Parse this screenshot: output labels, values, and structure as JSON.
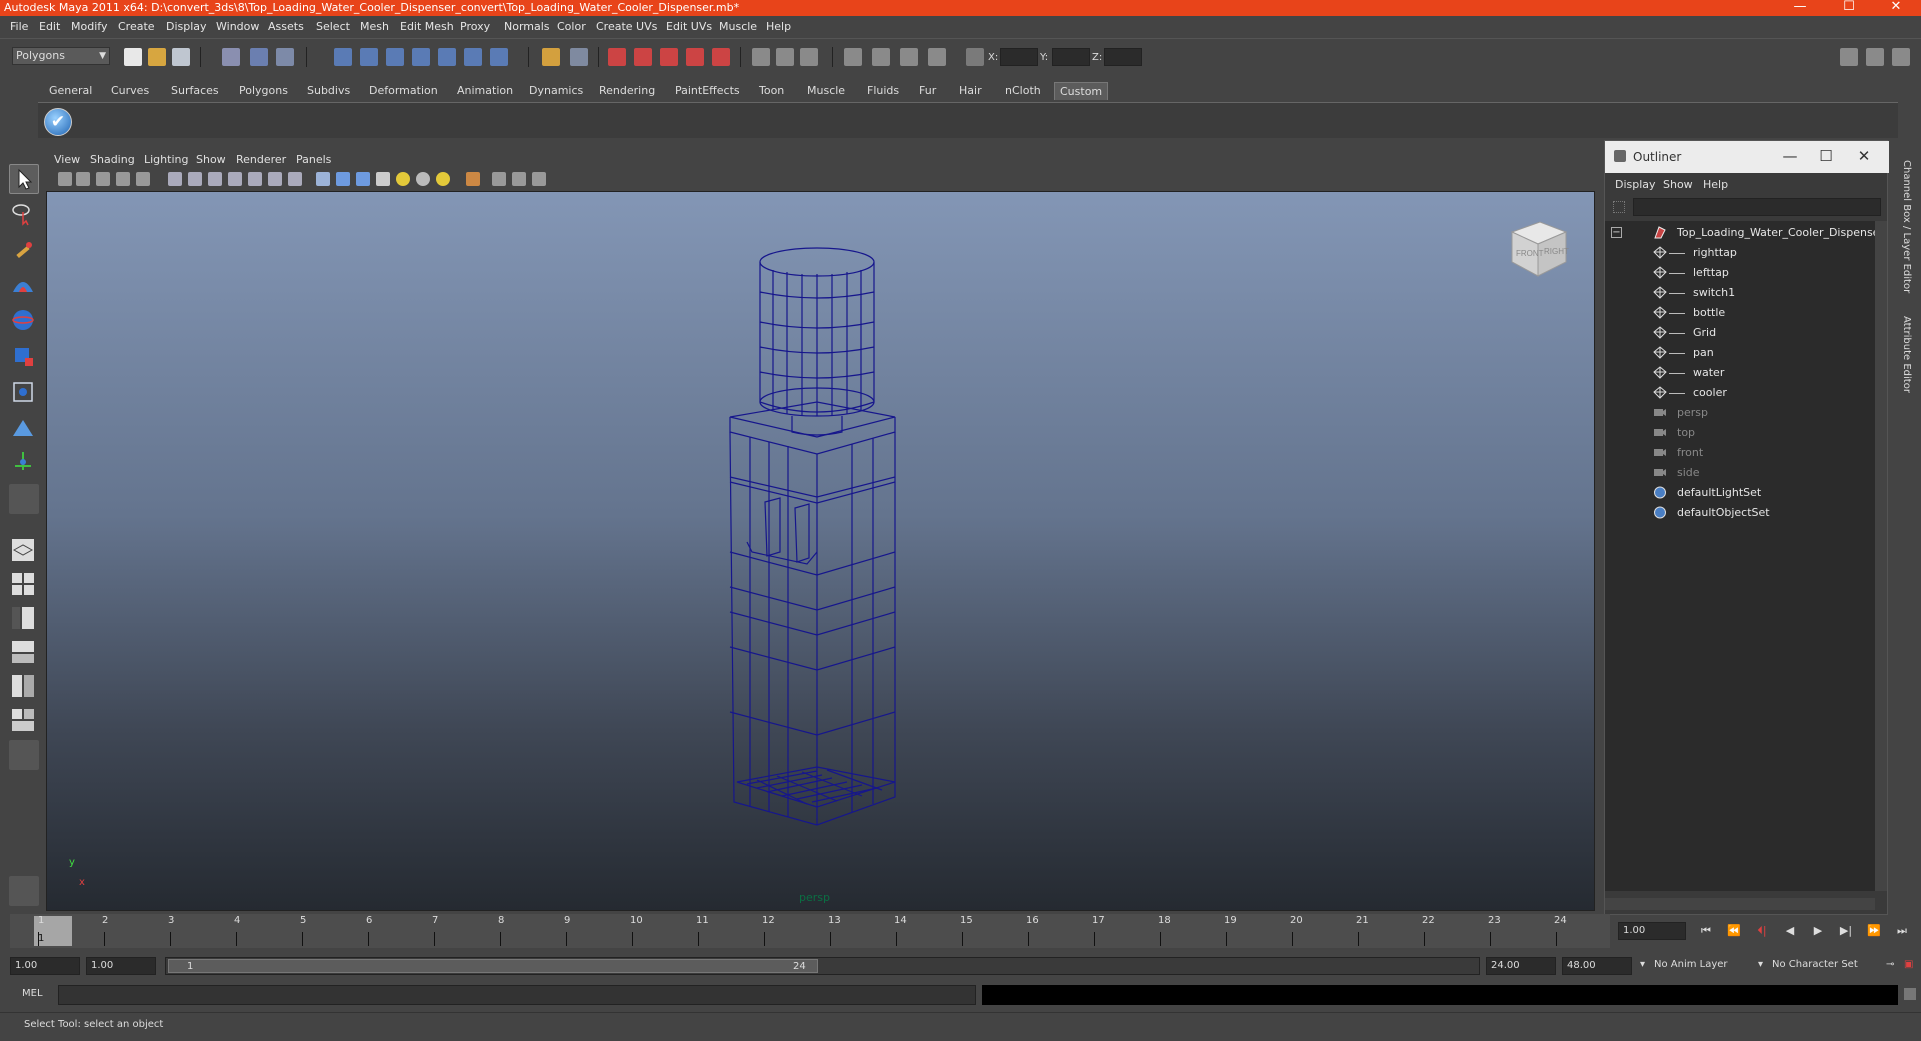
{
  "window": {
    "title": "Autodesk Maya 2011 x64: D:\\convert_3ds\\8\\Top_Loading_Water_Cooler_Dispenser_convert\\Top_Loading_Water_Cooler_Dispenser.mb*",
    "minimize": "—",
    "maximize": "☐",
    "close": "✕"
  },
  "menubar": [
    "File",
    "Edit",
    "Modify",
    "Create",
    "Display",
    "Window",
    "Assets",
    "Select",
    "Mesh",
    "Edit Mesh",
    "Proxy",
    "Normals",
    "Color",
    "Create UVs",
    "Edit UVs",
    "Muscle",
    "Help"
  ],
  "statusline": {
    "mode": "Polygons",
    "x_label": "X:",
    "y_label": "Y:",
    "z_label": "Z:"
  },
  "shelf_tabs": [
    "General",
    "Curves",
    "Surfaces",
    "Polygons",
    "Subdivs",
    "Deformation",
    "Animation",
    "Dynamics",
    "Rendering",
    "PaintEffects",
    "Toon",
    "Muscle",
    "Fluids",
    "Fur",
    "Hair",
    "nCloth",
    "Custom"
  ],
  "shelf_active": "Custom",
  "panel_menu": [
    "View",
    "Shading",
    "Lighting",
    "Show",
    "Renderer",
    "Panels"
  ],
  "viewport": {
    "camera_label": "persp",
    "viewcube_front": "FRONT",
    "viewcube_right": "RIGHT",
    "axis_x": "x",
    "axis_y": "y"
  },
  "outliner": {
    "title": "Outliner",
    "menu": [
      "Display",
      "Show",
      "Help"
    ],
    "items": [
      {
        "label": "Top_Loading_Water_Cooler_Dispenser",
        "kind": "root",
        "dim": false
      },
      {
        "label": "righttap",
        "kind": "child",
        "dim": false
      },
      {
        "label": "lefttap",
        "kind": "child",
        "dim": false
      },
      {
        "label": "switch1",
        "kind": "child",
        "dim": false
      },
      {
        "label": "bottle",
        "kind": "child",
        "dim": false
      },
      {
        "label": "Grid",
        "kind": "child",
        "dim": false
      },
      {
        "label": "pan",
        "kind": "child",
        "dim": false
      },
      {
        "label": "water",
        "kind": "child",
        "dim": false
      },
      {
        "label": "cooler",
        "kind": "child",
        "dim": false
      },
      {
        "label": "persp",
        "kind": "camera",
        "dim": true
      },
      {
        "label": "top",
        "kind": "camera",
        "dim": true
      },
      {
        "label": "front",
        "kind": "camera",
        "dim": true
      },
      {
        "label": "side",
        "kind": "camera",
        "dim": true
      },
      {
        "label": "defaultLightSet",
        "kind": "set",
        "dim": false
      },
      {
        "label": "defaultObjectSet",
        "kind": "set",
        "dim": false
      }
    ]
  },
  "side_tabs": [
    "Channel Box / Layer Editor",
    "Attribute Editor"
  ],
  "timeline": {
    "ticks": [
      "1",
      "2",
      "3",
      "4",
      "5",
      "6",
      "7",
      "8",
      "9",
      "10",
      "11",
      "12",
      "13",
      "14",
      "15",
      "16",
      "17",
      "18",
      "19",
      "20",
      "21",
      "22",
      "23",
      "24"
    ],
    "current_frame": "1",
    "current_field": "1.00",
    "playback": [
      "⏮",
      "⏪",
      "⏴|",
      "◀",
      "▶",
      "▶|",
      "⏩",
      "⏭"
    ]
  },
  "range": {
    "start": "1.00",
    "anim_start": "1.00",
    "slider_start": "1",
    "slider_end": "24",
    "end": "24.00",
    "anim_end": "48.00",
    "anim_layer": "No Anim Layer",
    "char_set": "No Character Set"
  },
  "cmdline": {
    "lang": "MEL"
  },
  "help_line": "Select Tool: select an object",
  "colors": {
    "title_bg": "#e8441a",
    "wire": "#16168c",
    "viewport_top": "#8396b5",
    "viewport_bottom": "#252a31"
  }
}
